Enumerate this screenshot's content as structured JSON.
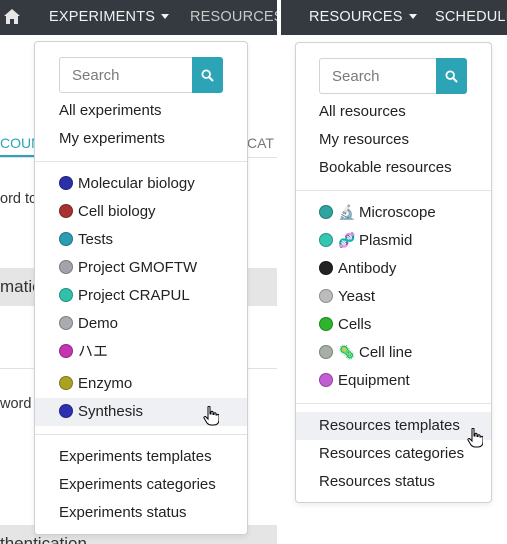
{
  "left": {
    "nav": {
      "experiments_label": "EXPERIMENTS",
      "resources_label": "RESOURCES"
    },
    "background": {
      "tab_active": "COUN",
      "tab_other": "CAT",
      "line1": "ord to",
      "band1": "matio",
      "line2": "word",
      "band2": "thentication"
    },
    "dropdown": {
      "search_placeholder": "Search",
      "links": [
        "All experiments",
        "My experiments"
      ],
      "categories": [
        {
          "label": "Molecular biology",
          "color": "#2b2fa8"
        },
        {
          "label": "Cell biology",
          "color": "#a83232"
        },
        {
          "label": "Tests",
          "color": "#2a9db3"
        },
        {
          "label": "Project GMOFTW",
          "color": "#a3a3ab"
        },
        {
          "label": "Project CRAPUL",
          "color": "#2fc1a9"
        },
        {
          "label": "Demo",
          "color": "#a8abaf"
        },
        {
          "label": "ハエ",
          "color": "#c434b3"
        },
        {
          "label": "Enzymo",
          "color": "#aaa221"
        },
        {
          "label": "Synthesis",
          "color": "#2d31b0"
        }
      ],
      "footer": [
        "Experiments templates",
        "Experiments categories",
        "Experiments status"
      ]
    }
  },
  "right": {
    "nav": {
      "resources_label": "RESOURCES",
      "scheduler_label": "SCHEDULE"
    },
    "dropdown": {
      "search_placeholder": "Search",
      "links": [
        "All resources",
        "My resources",
        "Bookable resources"
      ],
      "categories": [
        {
          "label": "Microscope",
          "color": "#2ea5a1",
          "emoji": "🔬"
        },
        {
          "label": "Plasmid",
          "color": "#35c6b1",
          "emoji": "🧬"
        },
        {
          "label": "Antibody",
          "color": "#222222"
        },
        {
          "label": "Yeast",
          "color": "#bcbcbc"
        },
        {
          "label": "Cells",
          "color": "#2db52d"
        },
        {
          "label": "Cell line",
          "color": "#a3b0a3",
          "emoji": "🦠"
        },
        {
          "label": "Equipment",
          "color": "#c15ed3"
        }
      ],
      "footer": [
        "Resources templates",
        "Resources categories",
        "Resources status"
      ]
    }
  }
}
